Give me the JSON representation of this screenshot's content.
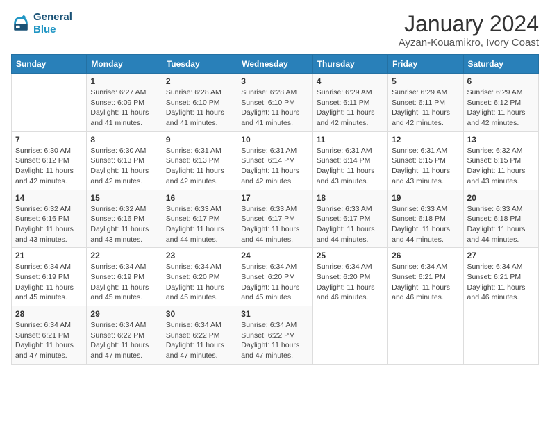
{
  "header": {
    "logo_line1": "General",
    "logo_line2": "Blue",
    "title": "January 2024",
    "subtitle": "Ayzan-Kouamikro, Ivory Coast"
  },
  "days_of_week": [
    "Sunday",
    "Monday",
    "Tuesday",
    "Wednesday",
    "Thursday",
    "Friday",
    "Saturday"
  ],
  "weeks": [
    [
      {
        "day": "",
        "info": ""
      },
      {
        "day": "1",
        "info": "Sunrise: 6:27 AM\nSunset: 6:09 PM\nDaylight: 11 hours\nand 41 minutes."
      },
      {
        "day": "2",
        "info": "Sunrise: 6:28 AM\nSunset: 6:10 PM\nDaylight: 11 hours\nand 41 minutes."
      },
      {
        "day": "3",
        "info": "Sunrise: 6:28 AM\nSunset: 6:10 PM\nDaylight: 11 hours\nand 41 minutes."
      },
      {
        "day": "4",
        "info": "Sunrise: 6:29 AM\nSunset: 6:11 PM\nDaylight: 11 hours\nand 42 minutes."
      },
      {
        "day": "5",
        "info": "Sunrise: 6:29 AM\nSunset: 6:11 PM\nDaylight: 11 hours\nand 42 minutes."
      },
      {
        "day": "6",
        "info": "Sunrise: 6:29 AM\nSunset: 6:12 PM\nDaylight: 11 hours\nand 42 minutes."
      }
    ],
    [
      {
        "day": "7",
        "info": "Sunrise: 6:30 AM\nSunset: 6:12 PM\nDaylight: 11 hours\nand 42 minutes."
      },
      {
        "day": "8",
        "info": "Sunrise: 6:30 AM\nSunset: 6:13 PM\nDaylight: 11 hours\nand 42 minutes."
      },
      {
        "day": "9",
        "info": "Sunrise: 6:31 AM\nSunset: 6:13 PM\nDaylight: 11 hours\nand 42 minutes."
      },
      {
        "day": "10",
        "info": "Sunrise: 6:31 AM\nSunset: 6:14 PM\nDaylight: 11 hours\nand 42 minutes."
      },
      {
        "day": "11",
        "info": "Sunrise: 6:31 AM\nSunset: 6:14 PM\nDaylight: 11 hours\nand 43 minutes."
      },
      {
        "day": "12",
        "info": "Sunrise: 6:31 AM\nSunset: 6:15 PM\nDaylight: 11 hours\nand 43 minutes."
      },
      {
        "day": "13",
        "info": "Sunrise: 6:32 AM\nSunset: 6:15 PM\nDaylight: 11 hours\nand 43 minutes."
      }
    ],
    [
      {
        "day": "14",
        "info": "Sunrise: 6:32 AM\nSunset: 6:16 PM\nDaylight: 11 hours\nand 43 minutes."
      },
      {
        "day": "15",
        "info": "Sunrise: 6:32 AM\nSunset: 6:16 PM\nDaylight: 11 hours\nand 43 minutes."
      },
      {
        "day": "16",
        "info": "Sunrise: 6:33 AM\nSunset: 6:17 PM\nDaylight: 11 hours\nand 44 minutes."
      },
      {
        "day": "17",
        "info": "Sunrise: 6:33 AM\nSunset: 6:17 PM\nDaylight: 11 hours\nand 44 minutes."
      },
      {
        "day": "18",
        "info": "Sunrise: 6:33 AM\nSunset: 6:17 PM\nDaylight: 11 hours\nand 44 minutes."
      },
      {
        "day": "19",
        "info": "Sunrise: 6:33 AM\nSunset: 6:18 PM\nDaylight: 11 hours\nand 44 minutes."
      },
      {
        "day": "20",
        "info": "Sunrise: 6:33 AM\nSunset: 6:18 PM\nDaylight: 11 hours\nand 44 minutes."
      }
    ],
    [
      {
        "day": "21",
        "info": "Sunrise: 6:34 AM\nSunset: 6:19 PM\nDaylight: 11 hours\nand 45 minutes."
      },
      {
        "day": "22",
        "info": "Sunrise: 6:34 AM\nSunset: 6:19 PM\nDaylight: 11 hours\nand 45 minutes."
      },
      {
        "day": "23",
        "info": "Sunrise: 6:34 AM\nSunset: 6:20 PM\nDaylight: 11 hours\nand 45 minutes."
      },
      {
        "day": "24",
        "info": "Sunrise: 6:34 AM\nSunset: 6:20 PM\nDaylight: 11 hours\nand 45 minutes."
      },
      {
        "day": "25",
        "info": "Sunrise: 6:34 AM\nSunset: 6:20 PM\nDaylight: 11 hours\nand 46 minutes."
      },
      {
        "day": "26",
        "info": "Sunrise: 6:34 AM\nSunset: 6:21 PM\nDaylight: 11 hours\nand 46 minutes."
      },
      {
        "day": "27",
        "info": "Sunrise: 6:34 AM\nSunset: 6:21 PM\nDaylight: 11 hours\nand 46 minutes."
      }
    ],
    [
      {
        "day": "28",
        "info": "Sunrise: 6:34 AM\nSunset: 6:21 PM\nDaylight: 11 hours\nand 47 minutes."
      },
      {
        "day": "29",
        "info": "Sunrise: 6:34 AM\nSunset: 6:22 PM\nDaylight: 11 hours\nand 47 minutes."
      },
      {
        "day": "30",
        "info": "Sunrise: 6:34 AM\nSunset: 6:22 PM\nDaylight: 11 hours\nand 47 minutes."
      },
      {
        "day": "31",
        "info": "Sunrise: 6:34 AM\nSunset: 6:22 PM\nDaylight: 11 hours\nand 47 minutes."
      },
      {
        "day": "",
        "info": ""
      },
      {
        "day": "",
        "info": ""
      },
      {
        "day": "",
        "info": ""
      }
    ]
  ]
}
